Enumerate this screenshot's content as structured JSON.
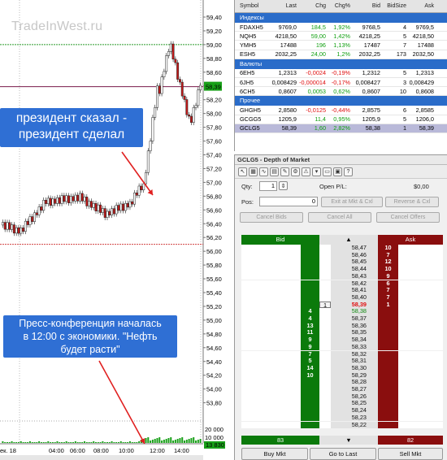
{
  "chart": {
    "watermark": "TradeInWest.ru",
    "price_axis_labels": [
      "59,40",
      "59,20",
      "59,00",
      "58,80",
      "58,60",
      "58,40",
      "58,20",
      "58,00",
      "57,80",
      "57,60",
      "57,40",
      "57,20",
      "57,00",
      "56,80",
      "56,60",
      "56,40",
      "56,20",
      "56,00",
      "55,80",
      "55,60",
      "55,40",
      "55,20",
      "55,00",
      "54,80",
      "54,60",
      "54,40",
      "54,20",
      "54,00",
      "53,80"
    ],
    "current_price_tag": "58,39",
    "volume_labels": [
      "20 000",
      "10 000",
      "13 830"
    ],
    "time_labels": [
      "ек. 18",
      "04:00",
      "06:00",
      "08:00",
      "10:00",
      "12:00",
      "14:00"
    ],
    "callouts": [
      {
        "lines": [
          "президент сказал -",
          "президент сделал"
        ]
      },
      {
        "lines": [
          "Пресс-конференция началась",
          "в 12:00 с экономики. \"Нефть",
          "будет расти\""
        ]
      }
    ],
    "colors": {
      "up": "#11a011",
      "down": "#e01010",
      "callout_bg": "#2f6fd4",
      "arrow": "#e02020"
    }
  },
  "quote_board": {
    "headers": [
      "Symbol",
      "Last",
      "Chg",
      "Chg%",
      "Bid",
      "BidSize",
      "Ask"
    ],
    "groups": [
      {
        "name": "Индексы",
        "rows": [
          {
            "symbol": "FDAXH5",
            "last": "9769,0",
            "chg": "184,5",
            "pct": "1,92%",
            "bid": "9768,5",
            "bidsize": "4",
            "ask": "9769,5",
            "dir": "up"
          },
          {
            "symbol": "NQH5",
            "last": "4218,50",
            "chg": "59,00",
            "pct": "1,42%",
            "bid": "4218,25",
            "bidsize": "5",
            "ask": "4218,50",
            "dir": "up"
          },
          {
            "symbol": "YMH5",
            "last": "17488",
            "chg": "196",
            "pct": "1,13%",
            "bid": "17487",
            "bidsize": "7",
            "ask": "17488",
            "dir": "up"
          },
          {
            "symbol": "ESH5",
            "last": "2032,25",
            "chg": "24,00",
            "pct": "1,2%",
            "bid": "2032,25",
            "bidsize": "173",
            "ask": "2032,50",
            "dir": "up"
          }
        ]
      },
      {
        "name": "Валюты",
        "rows": [
          {
            "symbol": "6EH5",
            "last": "1,2313",
            "chg": "-0,0024",
            "pct": "-0,19%",
            "bid": "1,2312",
            "bidsize": "5",
            "ask": "1,2313",
            "dir": "down"
          },
          {
            "symbol": "6JH5",
            "last": "0,008429",
            "chg": "-0,000014",
            "pct": "-0,17%",
            "bid": "0,008427",
            "bidsize": "3",
            "ask": "0,008429",
            "dir": "down"
          },
          {
            "symbol": "6CH5",
            "last": "0,8607",
            "chg": "0,0053",
            "pct": "0,62%",
            "bid": "0,8607",
            "bidsize": "10",
            "ask": "0,8608",
            "dir": "up"
          }
        ]
      },
      {
        "name": "Прочее",
        "rows": [
          {
            "symbol": "GHGH5",
            "last": "2,8580",
            "chg": "-0,0125",
            "pct": "-0,44%",
            "bid": "2,8575",
            "bidsize": "6",
            "ask": "2,8585",
            "dir": "down"
          },
          {
            "symbol": "GCGG5",
            "last": "1205,9",
            "chg": "11,4",
            "pct": "0,95%",
            "bid": "1205,9",
            "bidsize": "5",
            "ask": "1206,0",
            "dir": "up"
          },
          {
            "symbol": "GCLG5",
            "last": "58,39",
            "chg": "1,60",
            "pct": "2,82%",
            "bid": "58,38",
            "bidsize": "1",
            "ask": "58,39",
            "dir": "up",
            "selected": true
          }
        ]
      }
    ]
  },
  "dom": {
    "title": "GCLG5 - Depth of Market",
    "qty_label": "Qty:",
    "qty_value": "1",
    "pos_label": "Pos:",
    "pos_value": "0",
    "openpl_label": "Open P/L:",
    "openpl_value": "$0,00",
    "exit_label": "Exit at Mkt & Cxl",
    "reverse_label": "Reverse & Cxl",
    "cancel_bids": "Cancel Bids",
    "cancel_all": "Cancel All",
    "cancel_offers": "Cancel Offers",
    "bid_header": "Bid",
    "ask_header": "Ask",
    "bid_total": "83",
    "ask_total": "82",
    "buy_label": "Buy Mkt",
    "goto_label": "Go to Last",
    "sell_label": "Sell Mkt",
    "ladder": [
      {
        "price": "58,47",
        "ask": "10"
      },
      {
        "price": "58,46",
        "ask": "7"
      },
      {
        "price": "58,45",
        "ask": "12"
      },
      {
        "price": "58,44",
        "ask": "10"
      },
      {
        "price": "58,43",
        "ask": "9"
      },
      {
        "price": "58,42",
        "ask": "6"
      },
      {
        "price": "58,41",
        "ask": "7"
      },
      {
        "price": "58,40",
        "ask": "7"
      },
      {
        "price": "58,39",
        "ask": "1",
        "last": "1",
        "current": true
      },
      {
        "price": "58,38",
        "bid": "4"
      },
      {
        "price": "58,37",
        "bid": "4"
      },
      {
        "price": "58,36",
        "bid": "13"
      },
      {
        "price": "58,35",
        "bid": "11"
      },
      {
        "price": "58,34",
        "bid": "9"
      },
      {
        "price": "58,33",
        "bid": "9"
      },
      {
        "price": "58,32",
        "bid": "7"
      },
      {
        "price": "58,31",
        "bid": "5"
      },
      {
        "price": "58,30",
        "bid": "14"
      },
      {
        "price": "58,29",
        "bid": "10"
      },
      {
        "price": "58,28"
      },
      {
        "price": "58,27"
      },
      {
        "price": "58,26"
      },
      {
        "price": "58,25"
      },
      {
        "price": "58,24"
      },
      {
        "price": "58,23"
      },
      {
        "price": "58,22"
      }
    ],
    "colors": {
      "bid": "#0b7a0b",
      "ask": "#8a0e0e",
      "current": "#e01010",
      "bid_price": "#118811"
    }
  }
}
